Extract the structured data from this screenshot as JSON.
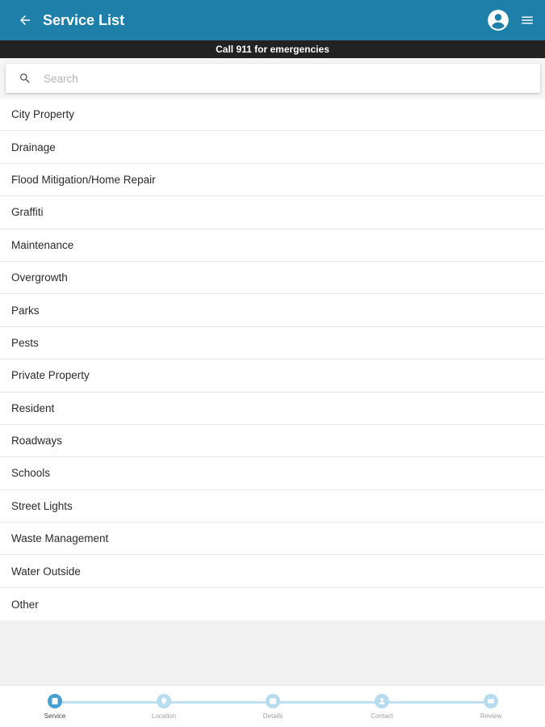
{
  "header": {
    "title": "Service List"
  },
  "banner": {
    "text": "Call 911 for emergencies"
  },
  "search": {
    "placeholder": "Search",
    "value": ""
  },
  "services": [
    {
      "label": "City Property"
    },
    {
      "label": "Drainage"
    },
    {
      "label": "Flood Mitigation/Home Repair"
    },
    {
      "label": "Graffiti"
    },
    {
      "label": "Maintenance"
    },
    {
      "label": "Overgrowth"
    },
    {
      "label": "Parks"
    },
    {
      "label": "Pests"
    },
    {
      "label": "Private Property"
    },
    {
      "label": "Resident"
    },
    {
      "label": "Roadways"
    },
    {
      "label": "Schools"
    },
    {
      "label": "Street Lights"
    },
    {
      "label": "Waste Management"
    },
    {
      "label": "Water Outside"
    },
    {
      "label": "Other"
    }
  ],
  "steps": [
    {
      "label": "Service",
      "icon": "service-icon",
      "active": true
    },
    {
      "label": "Location",
      "icon": "location-pin-icon",
      "active": false
    },
    {
      "label": "Details",
      "icon": "details-icon",
      "active": false
    },
    {
      "label": "Contact",
      "icon": "contact-person-icon",
      "active": false
    },
    {
      "label": "Review",
      "icon": "review-icon",
      "active": false
    }
  ],
  "colors": {
    "appbar": "#1e7fa8",
    "banner": "#222222",
    "step_active": "#4a9fd0",
    "step_inactive": "#b7dcf0"
  }
}
